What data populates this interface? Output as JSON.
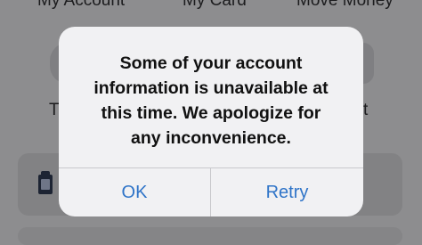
{
  "background": {
    "tabs": [
      "My Account",
      "My Card",
      "Move Money"
    ],
    "partial_text_left": "T",
    "partial_text_right": "t"
  },
  "alert": {
    "message_lines": [
      "Some of your account",
      "information is unavailable at",
      "this time. We apologize for",
      "any inconvenience."
    ],
    "buttons": {
      "ok": "OK",
      "retry": "Retry"
    }
  },
  "colors": {
    "dim_background": "#8d8d8f",
    "alert_background": "#f1f1f3",
    "button_text": "#2f74c8",
    "divider": "#c8c8cc"
  },
  "icons": {
    "card_icon": "clipboard-icon"
  }
}
